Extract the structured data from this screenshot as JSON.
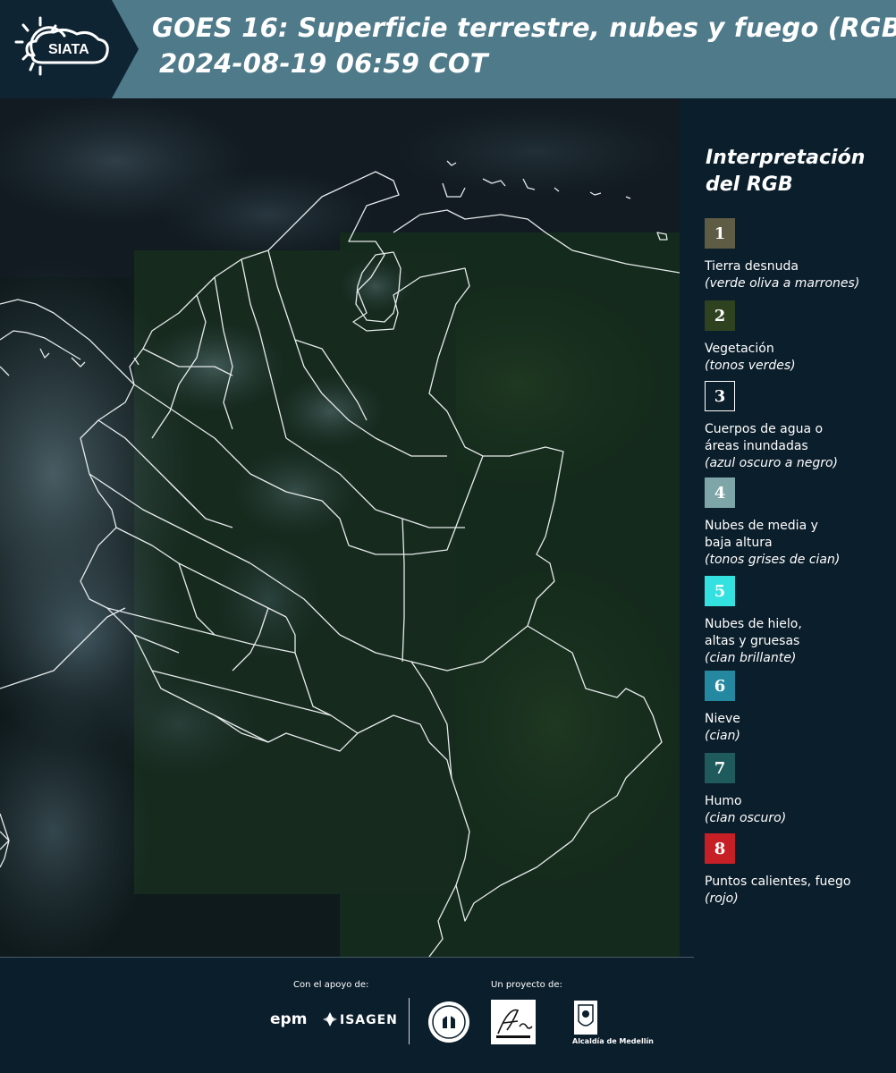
{
  "header": {
    "logo_text": "SIATA",
    "title_line1": "GOES 16: Superficie terrestre, nubes y fuego (RGB)",
    "title_line2": "2024-08-19 06:59 COT",
    "background_color": "#4e7a8a",
    "logo_block_color": "#0e2432"
  },
  "legend": {
    "title": "Interpretación del RGB",
    "items": [
      {
        "number": "1",
        "label": "Tierra desnuda",
        "desc": "(verde oliva a marrones)",
        "color": "#5e5c44"
      },
      {
        "number": "2",
        "label": "Vegetación",
        "desc": "(tonos verdes)",
        "color": "#2f4220"
      },
      {
        "number": "3",
        "label": "Cuerpos de agua o\náreas inundadas",
        "desc": "(azul oscuro a negro)",
        "color": "#0b1e2b"
      },
      {
        "number": "4",
        "label": "Nubes de media y\nbaja altura",
        "desc": "(tonos grises de cian)",
        "color": "#7ea5a7"
      },
      {
        "number": "5",
        "label": "Nubes de hielo,\naltas y gruesas",
        "desc": "(cian brillante)",
        "color": "#33e2e0"
      },
      {
        "number": "6",
        "label": "Nieve",
        "desc": "(cian)",
        "color": "#2489a0"
      },
      {
        "number": "7",
        "label": "Humo",
        "desc": "(cian oscuro)",
        "color": "#1f5a5c"
      },
      {
        "number": "8",
        "label": "Puntos calientes, fuego",
        "desc": "(rojo)",
        "color": "#c62026"
      }
    ]
  },
  "footer": {
    "support_label": "Con el apoyo de:",
    "project_label": "Un proyecto de:",
    "epm_text": "epm",
    "isagen_text": "ISAGEN",
    "alcaldia_text": "Alcaldía de Medellín"
  }
}
